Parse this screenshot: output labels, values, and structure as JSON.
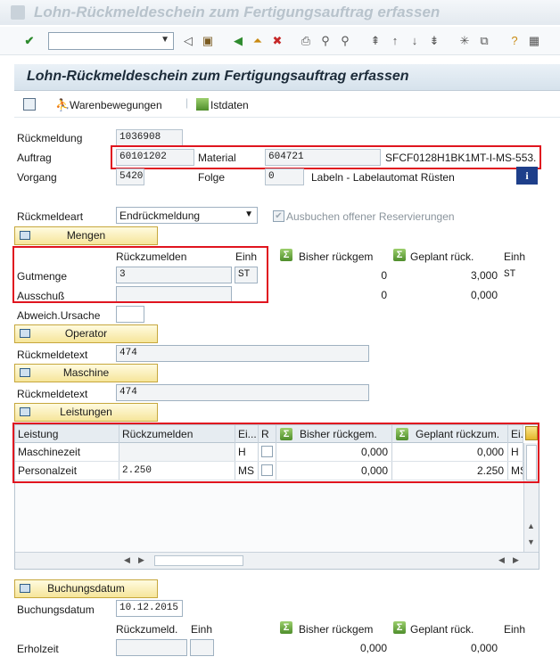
{
  "window": {
    "title": "Lohn-Rückmeldeschein zum Fertigungsauftrag erfassen"
  },
  "toolbar": {
    "command_value": ""
  },
  "app": {
    "title": "Lohn-Rückmeldeschein zum Fertigungsauftrag erfassen",
    "btn_warenbewegungen": "Warenbewegungen",
    "btn_istdaten": "Istdaten"
  },
  "header": {
    "rueckmeldung_label": "Rückmeldung",
    "rueckmeldung_value": "1036908",
    "auftrag_label": "Auftrag",
    "auftrag_value": "60101202",
    "material_label": "Material",
    "material_value": "604721",
    "material_desc": "SFCF0128H1BK1MT-I-MS-553...",
    "vorgang_label": "Vorgang",
    "vorgang_value": "5420",
    "folge_label": "Folge",
    "folge_value": "0",
    "vorgang_desc": "Labeln - Labelautomat Rüsten",
    "rueckmeldeart_label": "Rückmeldeart",
    "rueckmeldeart_value": "Endrückmeldung",
    "ausbuchen_label": "Ausbuchen offener Reservierungen"
  },
  "mengen": {
    "section": "Mengen",
    "col_rueckzumelden": "Rückzumelden",
    "col_einh": "Einh",
    "col_bisher": "Bisher rückgem",
    "col_geplant": "Geplant rück.",
    "col_einh2": "Einh",
    "gutmenge_label": "Gutmenge",
    "gutmenge_value": "3",
    "gutmenge_unit": "ST",
    "gutmenge_bisher": "0",
    "gutmenge_geplant": "3,000",
    "gutmenge_unit2": "ST",
    "ausschuss_label": "Ausschuß",
    "ausschuss_value": "",
    "ausschuss_bisher": "0",
    "ausschuss_geplant": "0,000",
    "abweich_label": "Abweich.Ursache",
    "abweich_value": ""
  },
  "operator": {
    "section": "Operator",
    "text_label": "Rückmeldetext",
    "text_value": "474"
  },
  "maschine": {
    "section": "Maschine",
    "text_label": "Rückmeldetext",
    "text_value": "474"
  },
  "leistungen": {
    "section": "Leistungen",
    "columns": [
      "Leistung",
      "Rückzumelden",
      "Ei...",
      "R",
      "Bisher rückgem.",
      "Geplant rückzum.",
      "Ei..."
    ],
    "rows": [
      {
        "leistung": "Maschinezeit",
        "rueck": "",
        "einh": "H",
        "bisher": "0,000",
        "geplant": "0,000",
        "einh2": "H"
      },
      {
        "leistung": "Personalzeit",
        "rueck": "2.250",
        "einh": "MS",
        "bisher": "0,000",
        "geplant": "2.250",
        "einh2": "MS"
      }
    ]
  },
  "buchung": {
    "section": "Buchungsdatum",
    "datum_label": "Buchungsdatum",
    "datum_value": "10.12.2015",
    "col_rueck": "Rückzumeld.",
    "col_einh": "Einh",
    "col_bisher": "Bisher rückgem",
    "col_geplant": "Geplant rück.",
    "col_einh2": "Einh",
    "erholzeit_label": "Erholzeit",
    "erholzeit_bisher": "0,000",
    "erholzeit_geplant": "0,000"
  },
  "colors": {
    "accent": "#e0151f",
    "section_bg": "#f6e59a",
    "header_bg": "#d6e2ec"
  }
}
